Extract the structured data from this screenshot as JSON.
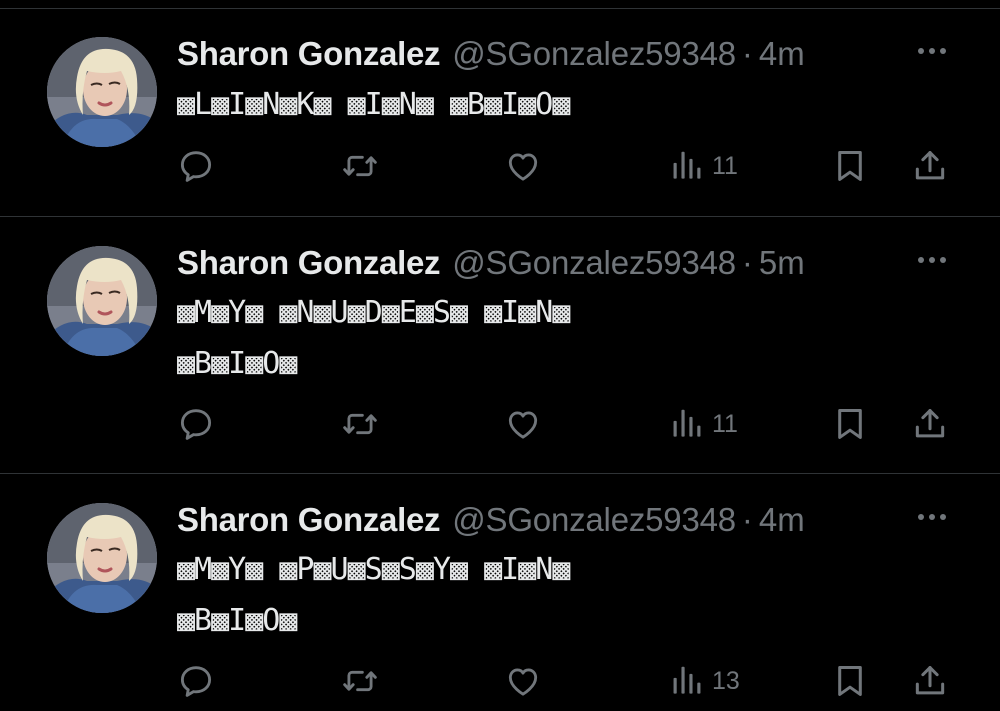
{
  "colors": {
    "background": "#000000",
    "text": "#e7e9ea",
    "secondary": "#71767b",
    "divider": "#2f3336"
  },
  "tweets": [
    {
      "author_name": "Sharon Gonzalez",
      "handle": "@SGonzalez59348",
      "separator": "·",
      "time": "4m",
      "text": "▩L▩I▩N▩K▩ ▩I▩N▩ ▩B▩I▩O▩",
      "views": "11",
      "icons": [
        "reply-icon",
        "retweet-icon",
        "like-icon",
        "views-icon",
        "bookmark-icon",
        "share-icon",
        "more-icon"
      ]
    },
    {
      "author_name": "Sharon Gonzalez",
      "handle": "@SGonzalez59348",
      "separator": "·",
      "time": "5m",
      "text": "▩M▩Y▩ ▩N▩U▩D▩E▩S▩ ▩I▩N▩\n▩B▩I▩O▩",
      "views": "11",
      "icons": [
        "reply-icon",
        "retweet-icon",
        "like-icon",
        "views-icon",
        "bookmark-icon",
        "share-icon",
        "more-icon"
      ]
    },
    {
      "author_name": "Sharon Gonzalez",
      "handle": "@SGonzalez59348",
      "separator": "·",
      "time": "4m",
      "text": "▩M▩Y▩ ▩P▩U▩S▩S▩Y▩ ▩I▩N▩\n▩B▩I▩O▩",
      "views": "13",
      "icons": [
        "reply-icon",
        "retweet-icon",
        "like-icon",
        "views-icon",
        "bookmark-icon",
        "share-icon",
        "more-icon"
      ]
    }
  ]
}
